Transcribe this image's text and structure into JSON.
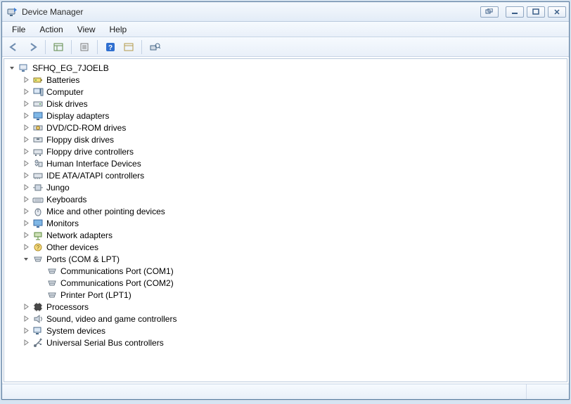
{
  "window": {
    "title": "Device Manager"
  },
  "menu": {
    "file": "File",
    "action": "Action",
    "view": "View",
    "help": "Help"
  },
  "root": {
    "label": "SFHQ_EG_7JOELB"
  },
  "categories": {
    "batteries": "Batteries",
    "computer": "Computer",
    "disk": "Disk drives",
    "display": "Display adapters",
    "dvd": "DVD/CD-ROM drives",
    "floppy_disk": "Floppy disk drives",
    "floppy_ctrl": "Floppy drive controllers",
    "hid": "Human Interface Devices",
    "ide": "IDE ATA/ATAPI controllers",
    "jungo": "Jungo",
    "keyboards": "Keyboards",
    "mice": "Mice and other pointing devices",
    "monitors": "Monitors",
    "network": "Network adapters",
    "other": "Other devices",
    "ports": "Ports (COM & LPT)",
    "processors": "Processors",
    "sound": "Sound, video and game controllers",
    "system": "System devices",
    "usb": "Universal Serial Bus controllers"
  },
  "ports_children": {
    "com1": "Communications Port (COM1)",
    "com2": "Communications Port (COM2)",
    "lpt1": "Printer Port (LPT1)"
  }
}
